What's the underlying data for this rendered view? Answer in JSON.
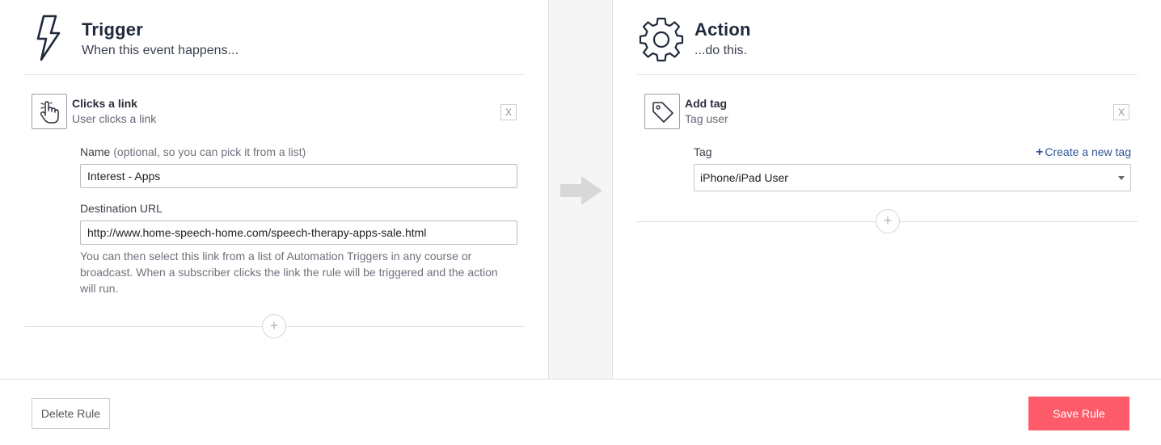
{
  "trigger": {
    "title": "Trigger",
    "subtitle": "When this event happens...",
    "icon": "lightning-icon",
    "card": {
      "icon": "pointer-hand-icon",
      "title": "Clicks a link",
      "subtitle": "User clicks a link",
      "close_label": "X"
    },
    "name_field": {
      "label": "Name",
      "hint": "(optional, so you can pick it from a list)",
      "value": "Interest - Apps"
    },
    "url_field": {
      "label": "Destination URL",
      "value": "http://www.home-speech-home.com/speech-therapy-apps-sale.html"
    },
    "help_text": "You can then select this link from a list of Automation Triggers in any course or broadcast. When a subscriber clicks the link the rule will be triggered and the action will run.",
    "add_label": "+"
  },
  "arrow": {
    "icon": "arrow-right-icon"
  },
  "action": {
    "title": "Action",
    "subtitle": "...do this.",
    "icon": "gear-icon",
    "card": {
      "icon": "tag-icon",
      "title": "Add tag",
      "subtitle": "Tag user",
      "close_label": "X"
    },
    "tag_field": {
      "label": "Tag",
      "create_label": "Create a new tag",
      "selected": "iPhone/iPad User"
    },
    "add_label": "+"
  },
  "footer": {
    "delete_label": "Delete Rule",
    "save_label": "Save Rule"
  },
  "colors": {
    "save_button": "#fd5b6a",
    "link": "#2f5597",
    "heading": "#1f2a3c",
    "middle_bg": "#f5f5f5"
  }
}
